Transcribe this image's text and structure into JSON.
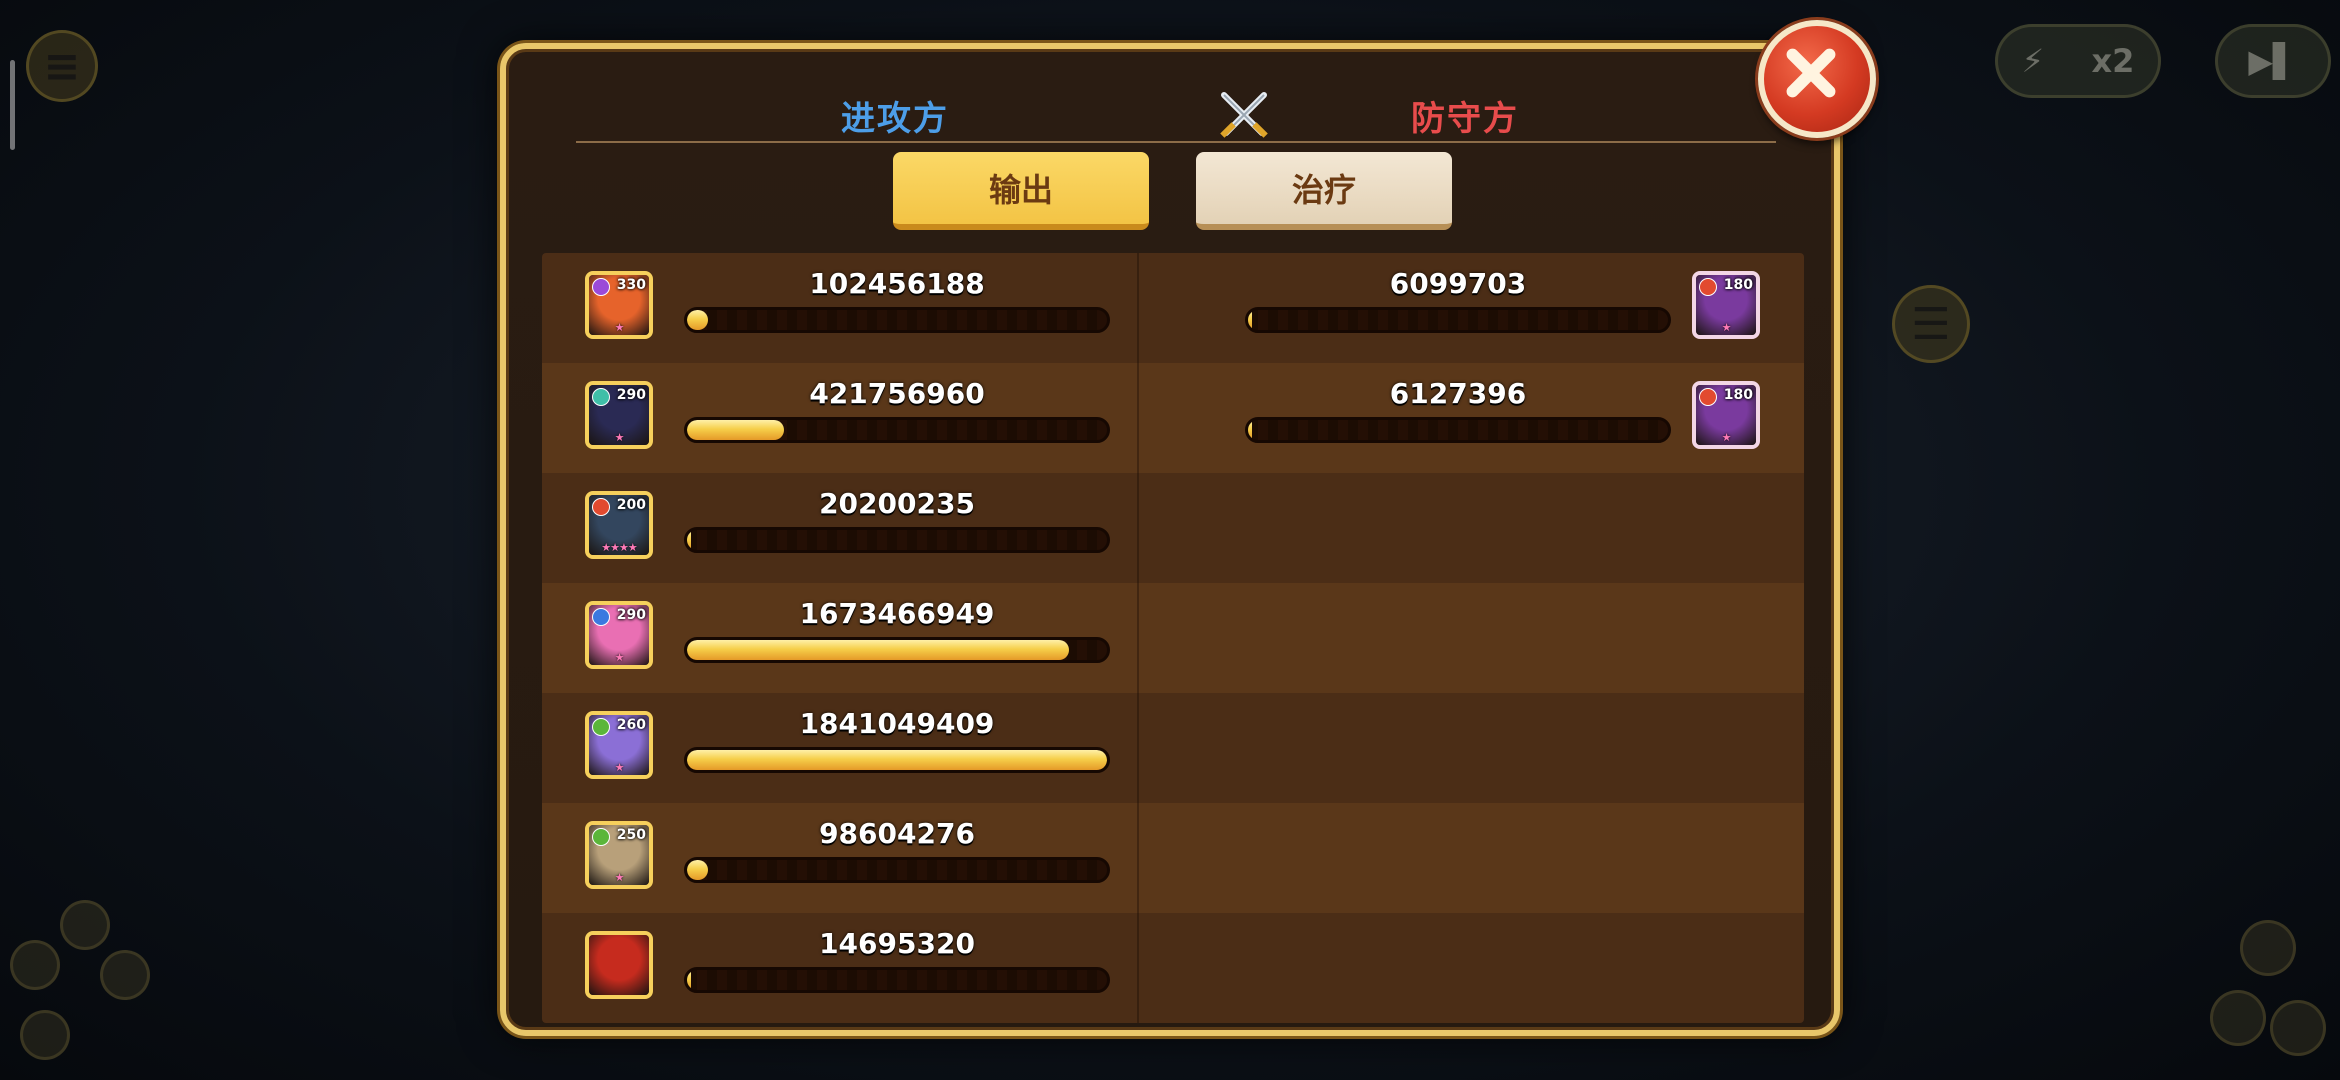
{
  "background": {
    "speed_label": "x2"
  },
  "panel": {
    "attacker_label": "进攻方",
    "defender_label": "防守方",
    "tabs": [
      {
        "label": "输出",
        "active": true
      },
      {
        "label": "治疗",
        "active": false
      }
    ]
  },
  "attackers": [
    {
      "level": "330",
      "value": "102456188",
      "progress": 0.05,
      "element_color": "#9b4ad8",
      "portrait_color": "#e6632b",
      "stars": "★"
    },
    {
      "level": "290",
      "value": "421756960",
      "progress": 0.23,
      "element_color": "#3fbfa8",
      "portrait_color": "#2a2a54",
      "stars": "★"
    },
    {
      "level": "200",
      "value": "20200235",
      "progress": 0.01,
      "element_color": "#e24a2f",
      "portrait_color": "#33465e",
      "stars": "★★★★"
    },
    {
      "level": "290",
      "value": "1673466949",
      "progress": 0.91,
      "element_color": "#3b79e0",
      "portrait_color": "#e96fb3",
      "stars": "★"
    },
    {
      "level": "260",
      "value": "1841049409",
      "progress": 1.0,
      "element_color": "#5bb63a",
      "portrait_color": "#8b6fd6",
      "stars": "★"
    },
    {
      "level": "250",
      "value": "98604276",
      "progress": 0.05,
      "element_color": "#5bb63a",
      "portrait_color": "#b8a07a",
      "stars": "★"
    },
    {
      "level": "",
      "value": "14695320",
      "progress": 0.01,
      "element_color": "",
      "portrait_color": "#c62b1e",
      "stars": ""
    }
  ],
  "defenders": [
    {
      "level": "180",
      "value": "6099703",
      "progress": 0.01,
      "element_color": "#e24a2f",
      "portrait_color": "#7a3a9e",
      "stars": "★"
    },
    {
      "level": "180",
      "value": "6127396",
      "progress": 0.01,
      "element_color": "#e24a2f",
      "portrait_color": "#7a3a9e",
      "stars": "★"
    }
  ]
}
